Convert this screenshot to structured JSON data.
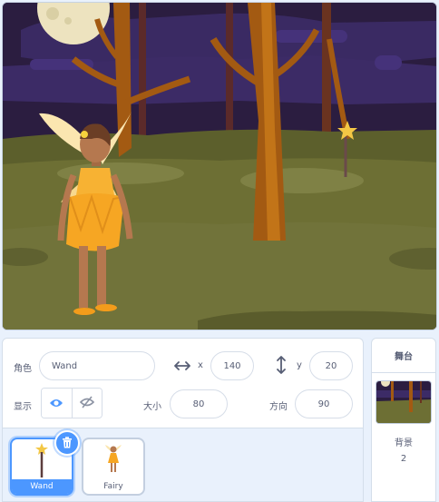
{
  "sprite_info": {
    "sprite_label": "角色",
    "sprite_name": "Wand",
    "x_label": "x",
    "x_value": "140",
    "y_label": "y",
    "y_value": "20",
    "show_label": "显示",
    "size_label": "大小",
    "size_value": "80",
    "direction_label": "方向",
    "direction_value": "90"
  },
  "sprites": [
    {
      "name": "Wand",
      "selected": true
    },
    {
      "name": "Fairy",
      "selected": false
    }
  ],
  "stage_pane": {
    "header": "舞台",
    "backdrops_label": "背景",
    "backdrops_count": "2"
  },
  "colors": {
    "accent": "#4c97ff",
    "sky": "#2a1c3e",
    "ground": "#6e6f34"
  }
}
